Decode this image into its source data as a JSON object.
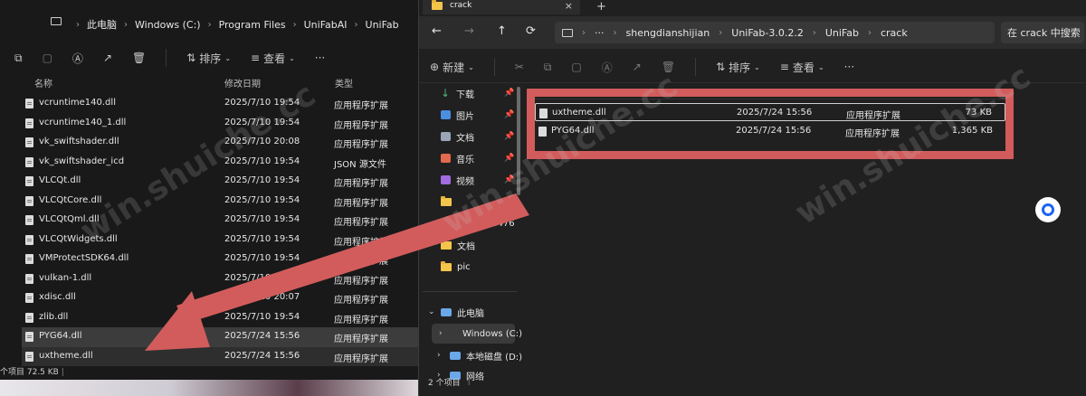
{
  "left_window": {
    "breadcrumb": [
      "此电脑",
      "Windows (C:)",
      "Program Files",
      "UniFabAI",
      "UniFab"
    ],
    "toolbar": {
      "sort_label": "排序",
      "view_label": "查看",
      "more_label": "···"
    },
    "columns": {
      "name": "名称",
      "date": "修改日期",
      "type": "类型"
    },
    "rows": [
      {
        "name": "vcruntime140.dll",
        "date": "2025/7/10 19:54",
        "type": "应用程序扩展"
      },
      {
        "name": "vcruntime140_1.dll",
        "date": "2025/7/10 19:54",
        "type": "应用程序扩展"
      },
      {
        "name": "vk_swiftshader.dll",
        "date": "2025/7/10 20:08",
        "type": "应用程序扩展"
      },
      {
        "name": "vk_swiftshader_icd",
        "date": "2025/7/10 19:54",
        "type": "JSON 源文件"
      },
      {
        "name": "VLCQt.dll",
        "date": "2025/7/10 19:54",
        "type": "应用程序扩展"
      },
      {
        "name": "VLCQtCore.dll",
        "date": "2025/7/10 19:54",
        "type": "应用程序扩展"
      },
      {
        "name": "VLCQtQml.dll",
        "date": "2025/7/10 19:54",
        "type": "应用程序扩展"
      },
      {
        "name": "VLCQtWidgets.dll",
        "date": "2025/7/10 19:54",
        "type": "应用程序扩展"
      },
      {
        "name": "VMProtectSDK64.dll",
        "date": "2025/7/10 19:54",
        "type": "应用程序扩展"
      },
      {
        "name": "vulkan-1.dll",
        "date": "2025/7/10 20:08",
        "type": "应用程序扩展"
      },
      {
        "name": "xdisc.dll",
        "date": "2025/7/10 20:07",
        "type": "应用程序扩展"
      },
      {
        "name": "zlib.dll",
        "date": "2025/7/10 19:54",
        "type": "应用程序扩展"
      },
      {
        "name": "PYG64.dll",
        "date": "2025/7/24 15:56",
        "type": "应用程序扩展"
      },
      {
        "name": "uxtheme.dll",
        "date": "2025/7/24 15:56",
        "type": "应用程序扩展"
      }
    ],
    "status": "个项目  72.5 KB"
  },
  "right_window": {
    "tab_title": "crack",
    "tab_close": "×",
    "tab_add": "+",
    "nav": {
      "back": "←",
      "forward": "→",
      "up": "↑",
      "refresh": "⟳",
      "more": "···"
    },
    "breadcrumb": [
      "shengdianshijian",
      "UniFab-3.0.2.2",
      "UniFab",
      "crack"
    ],
    "search_placeholder": "在 crack 中搜索",
    "toolbar": {
      "new_label": "新建",
      "sort_label": "排序",
      "view_label": "查看",
      "more_label": "···"
    },
    "sidebar": [
      {
        "label": "下载",
        "icon": "download-icon",
        "pinned": true
      },
      {
        "label": "图片",
        "icon": "pictures-icon",
        "pinned": true
      },
      {
        "label": "文档",
        "icon": "documents-icon",
        "pinned": true
      },
      {
        "label": "音乐",
        "icon": "music-icon",
        "pinned": true
      },
      {
        "label": "视频",
        "icon": "videos-icon",
        "pinned": true
      },
      {
        "label": "",
        "icon": "folder-icon",
        "pinned": false
      },
      {
        "label": "1620906476",
        "icon": "folder-icon",
        "pinned": false
      },
      {
        "label": "文档",
        "icon": "folder-icon",
        "pinned": false
      },
      {
        "label": "pic",
        "icon": "folder-icon",
        "pinned": false
      }
    ],
    "tree": {
      "this_pc": "此电脑",
      "windows_c": "Windows (C:)",
      "local_d": "本地磁盘 (D:)",
      "network": "网络"
    },
    "files": [
      {
        "name": "uxtheme.dll",
        "date": "2025/7/24 15:56",
        "type": "应用程序扩展",
        "size": "73 KB"
      },
      {
        "name": "PYG64.dll",
        "date": "2025/7/24 15:56",
        "type": "应用程序扩展",
        "size": "1,365 KB"
      }
    ],
    "status": "2 个项目"
  },
  "watermark": "win.shuiche.cc",
  "colors": {
    "highlight": "#d25c5c",
    "folder": "#f3c54a",
    "accent": "#1d64f2"
  }
}
